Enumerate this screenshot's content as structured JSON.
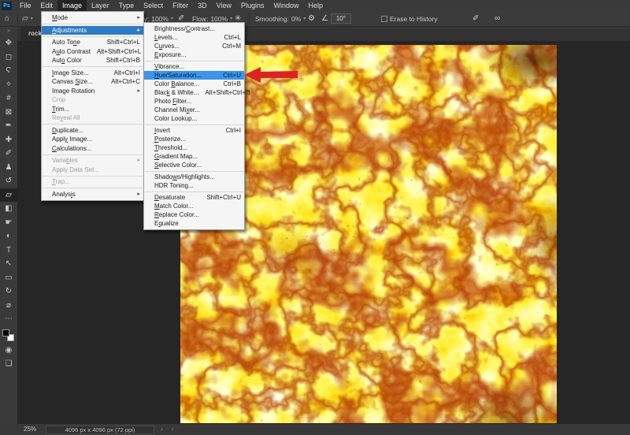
{
  "menu_bar": {
    "logo": "Ps",
    "items": [
      {
        "label": "File"
      },
      {
        "label": "Edit"
      },
      {
        "label": "Image",
        "active": true
      },
      {
        "label": "Layer"
      },
      {
        "label": "Type"
      },
      {
        "label": "Select"
      },
      {
        "label": "Filter"
      },
      {
        "label": "3D"
      },
      {
        "label": "View"
      },
      {
        "label": "Plugins"
      },
      {
        "label": "Window"
      },
      {
        "label": "Help"
      }
    ]
  },
  "options_bar": {
    "home_icon": "⌂",
    "tool_preset_icon": "▱",
    "caret": "▾",
    "opacity_label": "Opacity:",
    "opacity_value": "100%",
    "pressure_icon": "✐",
    "flow_label": "Flow:",
    "flow_value": "100%",
    "airbrush_icon": "✳",
    "smoothing_label": "Smoothing:",
    "smoothing_value": "0%",
    "gear_icon": "⚙",
    "angle_icon": "∠",
    "angle_value": "10°",
    "erase_history_label": "Erase to History",
    "pressure_icon2": "✐",
    "symmetry_icon": "∞"
  },
  "tab": {
    "title": "rock_pit"
  },
  "toolbar": {
    "collapse_icon": "»",
    "tools": [
      {
        "name": "move-tool",
        "glyph": "✥"
      },
      {
        "name": "marquee-tool",
        "glyph": "◻"
      },
      {
        "name": "lasso-tool",
        "glyph": "Ϛ"
      },
      {
        "name": "magic-wand-tool",
        "glyph": "✧"
      },
      {
        "name": "crop-tool",
        "glyph": "#"
      },
      {
        "name": "frame-tool",
        "glyph": "⊠"
      },
      {
        "name": "eyedropper-tool",
        "glyph": "✒"
      },
      {
        "name": "healing-brush-tool",
        "glyph": "✚"
      },
      {
        "name": "brush-tool",
        "glyph": "✐"
      },
      {
        "name": "clone-stamp-tool",
        "glyph": "♟"
      },
      {
        "name": "history-brush-tool",
        "glyph": "↺"
      },
      {
        "name": "eraser-tool",
        "glyph": "▱",
        "selected": true
      },
      {
        "name": "gradient-tool",
        "glyph": "◧"
      },
      {
        "name": "smudge-tool",
        "glyph": "☛"
      },
      {
        "name": "dodge-tool",
        "glyph": "◐"
      },
      {
        "name": "type-tool",
        "glyph": "T"
      },
      {
        "name": "path-select-tool",
        "glyph": "↖"
      },
      {
        "name": "shape-tool",
        "glyph": "▭"
      },
      {
        "name": "rotate-view-tool",
        "glyph": "↻"
      },
      {
        "name": "zoom-tool",
        "glyph": "⌀"
      },
      {
        "name": "edit-toolbar",
        "glyph": "⋯"
      }
    ],
    "quick_mask_icon": "◉",
    "screen_mode_icon": "❏"
  },
  "image_menu": [
    {
      "label": "Mode",
      "u": "M",
      "submenu": true
    },
    {
      "sep": true
    },
    {
      "label": "Adjustments",
      "u": "A",
      "submenu": true,
      "highlighted": true
    },
    {
      "sep": true
    },
    {
      "label": "Auto Tone",
      "u": "n",
      "shortcut": "Shift+Ctrl+L"
    },
    {
      "label": "Auto Contrast",
      "u": "u",
      "shortcut": "Alt+Shift+Ctrl+L"
    },
    {
      "label": "Auto Color",
      "u": "o",
      "shortcut": "Shift+Ctrl+B"
    },
    {
      "sep": true
    },
    {
      "label": "Image Size...",
      "u": "I",
      "shortcut": "Alt+Ctrl+I"
    },
    {
      "label": "Canvas Size...",
      "u": "S",
      "shortcut": "Alt+Ctrl+C"
    },
    {
      "label": "Image Rotation",
      "submenu": true
    },
    {
      "label": "Crop",
      "disabled": true
    },
    {
      "label": "Trim...",
      "u": "T"
    },
    {
      "label": "Reveal All",
      "u": "v",
      "disabled": true
    },
    {
      "sep": true
    },
    {
      "label": "Duplicate...",
      "u": "D"
    },
    {
      "label": "Apply Image...",
      "u": "y"
    },
    {
      "label": "Calculations...",
      "u": "C"
    },
    {
      "sep": true
    },
    {
      "label": "Variables",
      "u": "b",
      "submenu": true,
      "disabled": true
    },
    {
      "label": "Apply Data Set...",
      "disabled": true
    },
    {
      "sep": true
    },
    {
      "label": "Trap...",
      "u": "T",
      "disabled": true
    },
    {
      "sep": true
    },
    {
      "label": "Analysis",
      "u": "i",
      "submenu": true
    }
  ],
  "adjustments_menu": [
    {
      "label": "Brightness/Contrast...",
      "u": "C"
    },
    {
      "label": "Levels...",
      "u": "L",
      "shortcut": "Ctrl+L"
    },
    {
      "label": "Curves...",
      "u": "u",
      "shortcut": "Ctrl+M"
    },
    {
      "label": "Exposure...",
      "u": "E"
    },
    {
      "sep": true
    },
    {
      "label": "Vibrance...",
      "u": "V"
    },
    {
      "label": "Hue/Saturation...",
      "u": "H",
      "shortcut": "Ctrl+U",
      "highlighted": true
    },
    {
      "label": "Color Balance...",
      "u": "B",
      "shortcut": "Ctrl+B"
    },
    {
      "label": "Black & White...",
      "u": "k",
      "shortcut": "Alt+Shift+Ctrl+B"
    },
    {
      "label": "Photo Filter...",
      "u": "F"
    },
    {
      "label": "Channel Mixer...",
      "u": "x"
    },
    {
      "label": "Color Lookup..."
    },
    {
      "sep": true
    },
    {
      "label": "Invert",
      "u": "I",
      "shortcut": "Ctrl+I"
    },
    {
      "label": "Posterize...",
      "u": "P"
    },
    {
      "label": "Threshold...",
      "u": "T"
    },
    {
      "label": "Gradient Map...",
      "u": "G"
    },
    {
      "label": "Selective Color...",
      "u": "S"
    },
    {
      "sep": true
    },
    {
      "label": "Shadows/Highlights...",
      "u": "w"
    },
    {
      "label": "HDR Toning..."
    },
    {
      "sep": true
    },
    {
      "label": "Desaturate",
      "u": "D",
      "shortcut": "Shift+Ctrl+U"
    },
    {
      "label": "Match Color...",
      "u": "M"
    },
    {
      "label": "Replace Color...",
      "u": "R"
    },
    {
      "label": "Equalize",
      "u": "q"
    }
  ],
  "status_bar": {
    "zoom": "25%",
    "doc_size": "4096 px x 4096 px (72 ppi)",
    "chevron": "›",
    "scroll_arrow": "‹"
  },
  "annotation": {
    "arrow_color": "#dd2222"
  },
  "colors": {
    "menu_highlight_main": "#2f7ac6",
    "menu_highlight_sub": "#3c95e8",
    "canvas_base": "#ffdf00",
    "canvas_crack": "#8a1e00",
    "canvas_highlight": "#ffffff"
  }
}
